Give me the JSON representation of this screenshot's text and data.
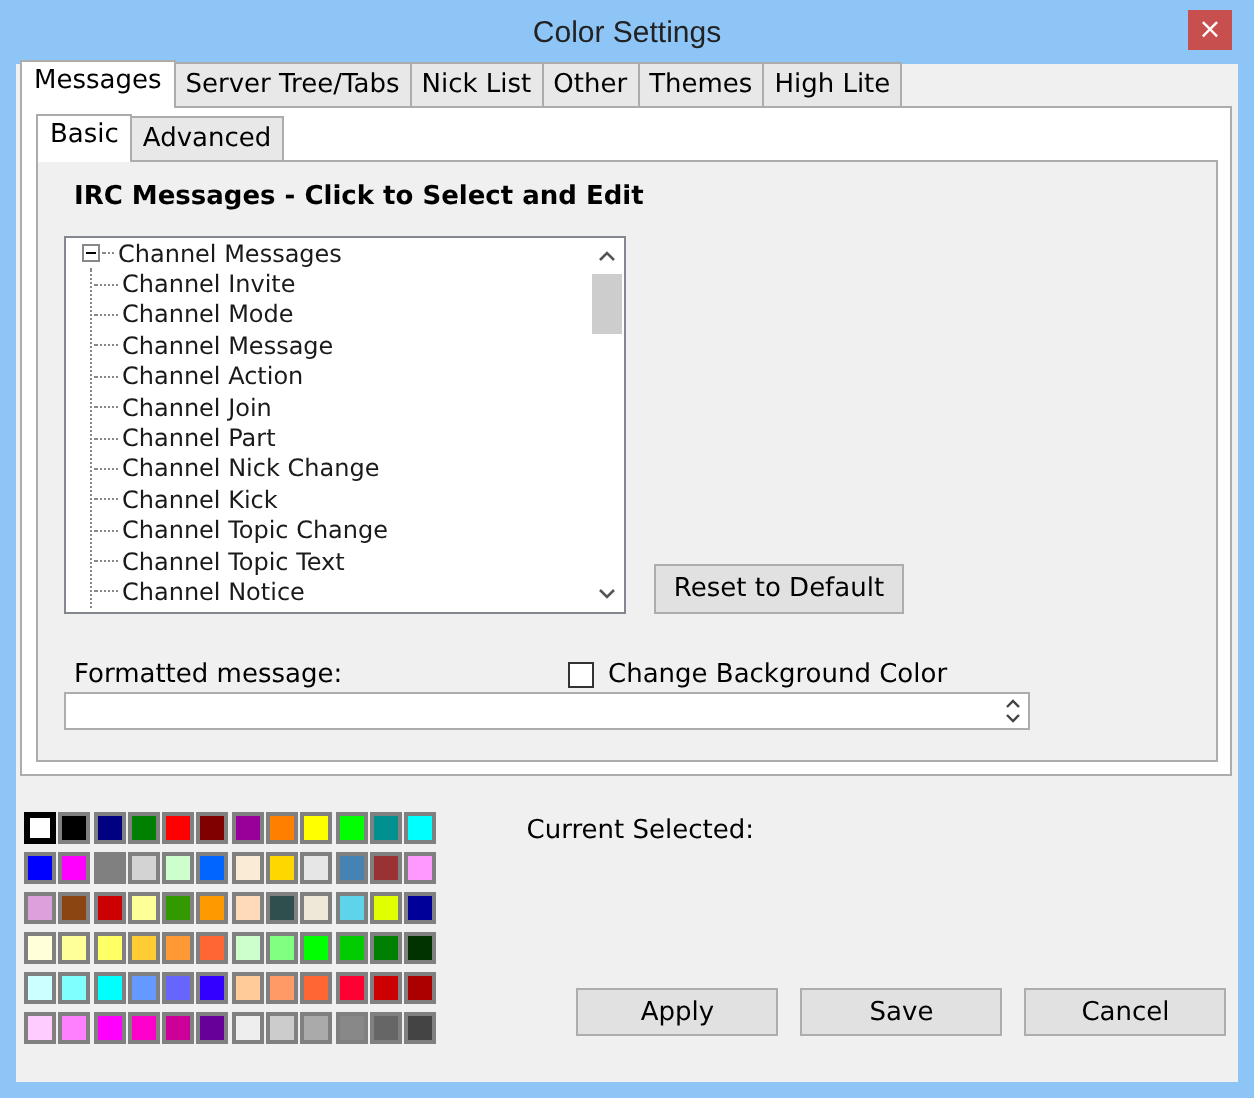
{
  "window": {
    "title": "Color Settings",
    "close": "×"
  },
  "tabs": [
    {
      "label": "Messages",
      "selected": true
    },
    {
      "label": "Server Tree/Tabs",
      "selected": false
    },
    {
      "label": "Nick List",
      "selected": false
    },
    {
      "label": "Other",
      "selected": false
    },
    {
      "label": "Themes",
      "selected": false
    },
    {
      "label": "High Lite",
      "selected": false
    }
  ],
  "subtabs": [
    {
      "label": "Basic",
      "selected": true
    },
    {
      "label": "Advanced",
      "selected": false
    }
  ],
  "heading": "IRC Messages - Click to Select and Edit",
  "tree": [
    {
      "label": "Channel Messages",
      "expanded": true,
      "children": [
        {
          "label": "Channel Invite"
        },
        {
          "label": "Channel Mode"
        },
        {
          "label": "Channel Message"
        },
        {
          "label": "Channel Action"
        },
        {
          "label": "Channel Join"
        },
        {
          "label": "Channel Part"
        },
        {
          "label": "Channel Nick Change"
        },
        {
          "label": "Channel Kick"
        },
        {
          "label": "Channel Topic Change"
        },
        {
          "label": "Channel Topic Text"
        },
        {
          "label": "Channel Notice"
        }
      ]
    }
  ],
  "reset_button": "Reset to Default",
  "formatted_label": "Formatted message:",
  "background_checkbox": {
    "label": "Change Background Color",
    "checked": false
  },
  "palette": [
    [
      {
        "color": "#ffffff",
        "selected": true
      },
      {
        "color": "#000000",
        "selected": false
      },
      {
        "color": "#000080",
        "selected": false
      },
      {
        "color": "#008000",
        "selected": false
      },
      {
        "color": "#ff0000",
        "selected": false
      },
      {
        "color": "#800000",
        "selected": false
      },
      {
        "color": "#990099",
        "selected": false
      },
      {
        "color": "#ff8000",
        "selected": false
      },
      {
        "color": "#ffff00",
        "selected": false
      },
      {
        "color": "#00ff00",
        "selected": false
      },
      {
        "color": "#009090",
        "selected": false
      },
      {
        "color": "#00ffff",
        "selected": false
      }
    ],
    [
      {
        "color": "#0000ff",
        "selected": false
      },
      {
        "color": "#ff00ff",
        "selected": false
      },
      {
        "color": "#808080",
        "selected": false
      },
      {
        "color": "#d3d3d3",
        "selected": false
      },
      {
        "color": "#ccffcc",
        "selected": false
      },
      {
        "color": "#0066ff",
        "selected": false
      },
      {
        "color": "#faebd7",
        "selected": false
      },
      {
        "color": "#ffd700",
        "selected": false
      },
      {
        "color": "#e6e6e6",
        "selected": false
      },
      {
        "color": "#4682b4",
        "selected": false
      },
      {
        "color": "#993333",
        "selected": false
      },
      {
        "color": "#ff99ff",
        "selected": false
      }
    ],
    [
      {
        "color": "#dda0dd",
        "selected": false
      },
      {
        "color": "#8b4513",
        "selected": false
      },
      {
        "color": "#cc0000",
        "selected": false
      },
      {
        "color": "#ffff99",
        "selected": false
      },
      {
        "color": "#339900",
        "selected": false
      },
      {
        "color": "#ff9900",
        "selected": false
      },
      {
        "color": "#ffdab9",
        "selected": false
      },
      {
        "color": "#2f4f4f",
        "selected": false
      },
      {
        "color": "#eee8d8",
        "selected": false
      },
      {
        "color": "#5ed4ea",
        "selected": false
      },
      {
        "color": "#e0ff00",
        "selected": false
      },
      {
        "color": "#000099",
        "selected": false
      }
    ],
    [
      {
        "color": "#ffffd9",
        "selected": false
      },
      {
        "color": "#ffff99",
        "selected": false
      },
      {
        "color": "#ffff66",
        "selected": false
      },
      {
        "color": "#ffcc33",
        "selected": false
      },
      {
        "color": "#ff9933",
        "selected": false
      },
      {
        "color": "#ff6633",
        "selected": false
      },
      {
        "color": "#ccffcc",
        "selected": false
      },
      {
        "color": "#80ff80",
        "selected": false
      },
      {
        "color": "#00ff00",
        "selected": false
      },
      {
        "color": "#00cc00",
        "selected": false
      },
      {
        "color": "#008000",
        "selected": false
      },
      {
        "color": "#003300",
        "selected": false
      }
    ],
    [
      {
        "color": "#ccffff",
        "selected": false
      },
      {
        "color": "#80ffff",
        "selected": false
      },
      {
        "color": "#00ffff",
        "selected": false
      },
      {
        "color": "#6699ff",
        "selected": false
      },
      {
        "color": "#6666ff",
        "selected": false
      },
      {
        "color": "#3300ff",
        "selected": false
      },
      {
        "color": "#ffcc99",
        "selected": false
      },
      {
        "color": "#ff9966",
        "selected": false
      },
      {
        "color": "#ff6633",
        "selected": false
      },
      {
        "color": "#ff0033",
        "selected": false
      },
      {
        "color": "#cc0000",
        "selected": false
      },
      {
        "color": "#aa0000",
        "selected": false
      }
    ],
    [
      {
        "color": "#ffccff",
        "selected": false
      },
      {
        "color": "#ff80ff",
        "selected": false
      },
      {
        "color": "#ff00ff",
        "selected": false
      },
      {
        "color": "#ff00cc",
        "selected": false
      },
      {
        "color": "#cc0099",
        "selected": false
      },
      {
        "color": "#660099",
        "selected": false
      },
      {
        "color": "#eeeeee",
        "selected": false
      },
      {
        "color": "#cccccc",
        "selected": false
      },
      {
        "color": "#aaaaaa",
        "selected": false
      },
      {
        "color": "#888888",
        "selected": false
      },
      {
        "color": "#666666",
        "selected": false
      },
      {
        "color": "#444444",
        "selected": false
      }
    ]
  ],
  "current_selected_label": "Current Selected:",
  "buttons": [
    "Apply",
    "Save",
    "Cancel"
  ]
}
